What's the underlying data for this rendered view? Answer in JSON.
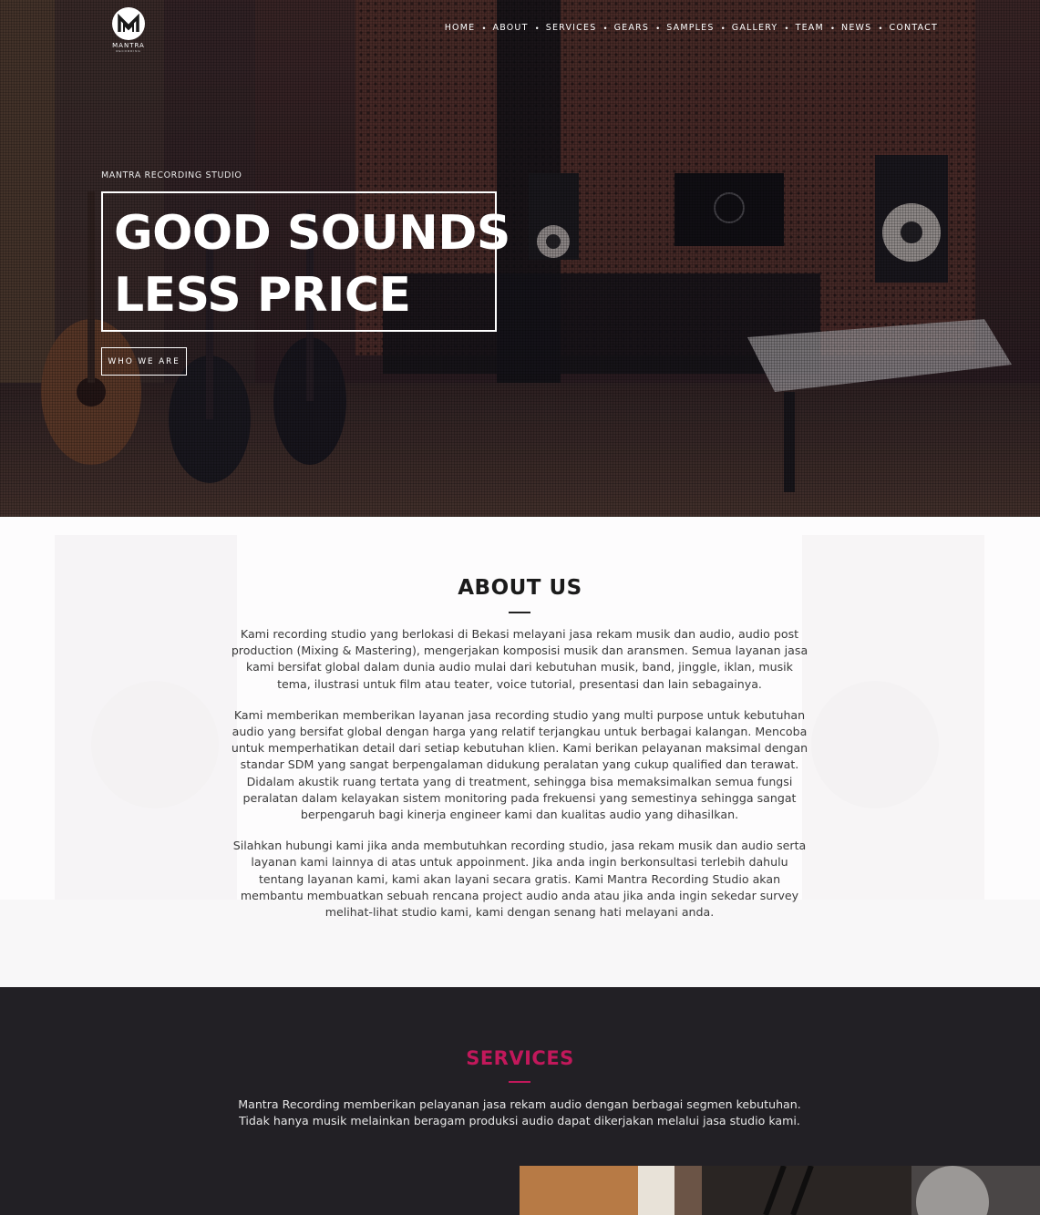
{
  "brand": {
    "logo_mark": "M",
    "logo_name": "MANTRA",
    "logo_sub": "RECORDING"
  },
  "nav": {
    "items": [
      {
        "label": "HOME"
      },
      {
        "label": "ABOUT"
      },
      {
        "label": "SERVICES"
      },
      {
        "label": "GEARS"
      },
      {
        "label": "SAMPLES"
      },
      {
        "label": "GALLERY"
      },
      {
        "label": "TEAM"
      },
      {
        "label": "NEWS"
      },
      {
        "label": "CONTACT"
      }
    ],
    "separator": "•"
  },
  "hero": {
    "kicker": "MANTRA RECORDING STUDIO",
    "headline_line1": "GOOD SOUNDS",
    "headline_line2": "LESS PRICE",
    "cta_label": "WHO WE ARE"
  },
  "about": {
    "title": "ABOUT US",
    "paragraphs": [
      "Kami recording studio yang berlokasi di Bekasi melayani jasa rekam musik dan audio, audio post production (Mixing & Mastering), mengerjakan komposisi musik dan aransmen. Semua layanan jasa kami bersifat global dalam dunia audio mulai dari kebutuhan musik, band, jinggle, iklan, musik tema, ilustrasi untuk film atau teater, voice tutorial, presentasi dan lain sebagainya.",
      "Kami memberikan memberikan layanan jasa recording studio yang multi purpose untuk kebutuhan audio yang bersifat global dengan harga yang relatif terjangkau untuk berbagai kalangan. Mencoba untuk memperhatikan detail dari setiap kebutuhan klien. Kami berikan pelayanan maksimal dengan standar SDM yang sangat berpengalaman didukung peralatan yang cukup qualified dan terawat. Didalam akustik ruang tertata yang di treatment, sehingga bisa memaksimalkan semua fungsi peralatan dalam kelayakan sistem monitoring pada frekuensi yang semestinya sehingga sangat berpengaruh bagi kinerja engineer kami dan kualitas audio yang dihasilkan.",
      "Silahkan hubungi kami jika anda membutuhkan recording studio, jasa rekam musik dan audio serta layanan kami lainnya di atas untuk appoinment. Jika anda ingin berkonsultasi terlebih dahulu tentang layanan kami, kami akan layani secara gratis. Kami Mantra Recording Studio akan membantu membuatkan sebuah rencana project audio anda atau jika anda ingin sekedar survey melihat-lihat studio kami, kami dengan senang hati melayani anda."
    ]
  },
  "services": {
    "title": "SERVICES",
    "intro": "Mantra Recording memberikan pelayanan jasa rekam audio dengan berbagai segmen kebutuhan. Tidak hanya musik melainkan beragam produksi audio dapat dikerjakan melalui jasa studio kami."
  },
  "colors": {
    "accent": "#c2185b",
    "dark_section": "#222025",
    "heading_dark": "#1b1b1b"
  }
}
